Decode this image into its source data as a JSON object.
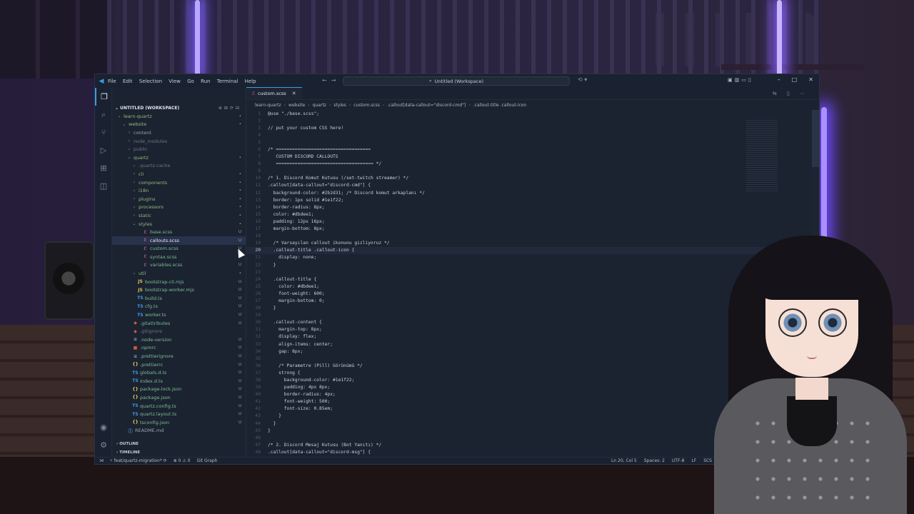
{
  "window": {
    "menu": [
      "File",
      "Edit",
      "Selection",
      "View",
      "Go",
      "Run",
      "Terminal",
      "Help"
    ],
    "search_title": "Untitled (Workspace)"
  },
  "sidebar": {
    "workspace": "UNTITLED (WORKSPACE)",
    "tree": [
      {
        "label": "learn-quartz",
        "depth": 0,
        "kind": "folder",
        "open": true,
        "status": "•",
        "status_kind": "mod"
      },
      {
        "label": "website",
        "depth": 1,
        "kind": "folder",
        "open": true,
        "status": "•",
        "status_kind": "mod"
      },
      {
        "label": "content",
        "depth": 2,
        "kind": "folder",
        "open": false,
        "status": "",
        "status_kind": ""
      },
      {
        "label": "node_modules",
        "depth": 2,
        "kind": "folder",
        "open": false,
        "status": "",
        "status_kind": "ign"
      },
      {
        "label": "public",
        "depth": 2,
        "kind": "folder",
        "open": false,
        "status": "",
        "status_kind": "ign"
      },
      {
        "label": "quartz",
        "depth": 2,
        "kind": "folder",
        "open": true,
        "status": "•",
        "status_kind": "mod"
      },
      {
        "label": ".quartz-cache",
        "depth": 3,
        "kind": "folder",
        "open": false,
        "status": "",
        "status_kind": "ign"
      },
      {
        "label": "cli",
        "depth": 3,
        "kind": "folder",
        "open": false,
        "status": "•",
        "status_kind": "mod"
      },
      {
        "label": "components",
        "depth": 3,
        "kind": "folder",
        "open": false,
        "status": "•",
        "status_kind": "mod"
      },
      {
        "label": "i18n",
        "depth": 3,
        "kind": "folder",
        "open": false,
        "status": "•",
        "status_kind": "mod"
      },
      {
        "label": "plugins",
        "depth": 3,
        "kind": "folder",
        "open": false,
        "status": "•",
        "status_kind": "mod"
      },
      {
        "label": "processors",
        "depth": 3,
        "kind": "folder",
        "open": false,
        "status": "•",
        "status_kind": "mod"
      },
      {
        "label": "static",
        "depth": 3,
        "kind": "folder",
        "open": false,
        "status": "•",
        "status_kind": "mod"
      },
      {
        "label": "styles",
        "depth": 3,
        "kind": "folder",
        "open": true,
        "status": "•",
        "status_kind": "mod"
      },
      {
        "label": "base.scss",
        "depth": 4,
        "kind": "sass",
        "status": "U",
        "status_kind": "un"
      },
      {
        "label": "callouts.scss",
        "depth": 4,
        "kind": "sass",
        "status": "U",
        "status_kind": "un",
        "selected": true
      },
      {
        "label": "custom.scss",
        "depth": 4,
        "kind": "sass",
        "status": "U",
        "status_kind": "un"
      },
      {
        "label": "syntax.scss",
        "depth": 4,
        "kind": "sass",
        "status": "U",
        "status_kind": "un"
      },
      {
        "label": "variables.scss",
        "depth": 4,
        "kind": "sass",
        "status": "U",
        "status_kind": "un"
      },
      {
        "label": "util",
        "depth": 3,
        "kind": "folder",
        "open": false,
        "status": "•",
        "status_kind": "mod"
      },
      {
        "label": "bootstrap-cli.mjs",
        "depth": 3,
        "kind": "js",
        "status": "U",
        "status_kind": "un"
      },
      {
        "label": "bootstrap-worker.mjs",
        "depth": 3,
        "kind": "js",
        "status": "U",
        "status_kind": "un"
      },
      {
        "label": "build.ts",
        "depth": 3,
        "kind": "ts",
        "status": "U",
        "status_kind": "un"
      },
      {
        "label": "cfg.ts",
        "depth": 3,
        "kind": "ts",
        "status": "U",
        "status_kind": "un"
      },
      {
        "label": "worker.ts",
        "depth": 3,
        "kind": "ts",
        "status": "U",
        "status_kind": "un"
      },
      {
        "label": ".gitattributes",
        "depth": 2,
        "kind": "git",
        "status": "U",
        "status_kind": "un"
      },
      {
        "label": ".gitignore",
        "depth": 2,
        "kind": "git",
        "status": "",
        "status_kind": "ign"
      },
      {
        "label": ".node-version",
        "depth": 2,
        "kind": "txt",
        "status": "U",
        "status_kind": "un"
      },
      {
        "label": ".npmrc",
        "depth": 2,
        "kind": "npm",
        "status": "U",
        "status_kind": "un"
      },
      {
        "label": ".prettierignore",
        "depth": 2,
        "kind": "txt",
        "status": "U",
        "status_kind": "un"
      },
      {
        "label": ".prettierrc",
        "depth": 2,
        "kind": "json",
        "status": "U",
        "status_kind": "un"
      },
      {
        "label": "globals.d.ts",
        "depth": 2,
        "kind": "ts",
        "status": "U",
        "status_kind": "un"
      },
      {
        "label": "index.d.ts",
        "depth": 2,
        "kind": "ts",
        "status": "U",
        "status_kind": "un"
      },
      {
        "label": "package-lock.json",
        "depth": 2,
        "kind": "json",
        "status": "U",
        "status_kind": "un"
      },
      {
        "label": "package.json",
        "depth": 2,
        "kind": "json",
        "status": "U",
        "status_kind": "un"
      },
      {
        "label": "quartz.config.ts",
        "depth": 2,
        "kind": "ts",
        "status": "U",
        "status_kind": "un"
      },
      {
        "label": "quartz.layout.ts",
        "depth": 2,
        "kind": "ts",
        "status": "U",
        "status_kind": "un"
      },
      {
        "label": "tsconfig.json",
        "depth": 2,
        "kind": "json",
        "status": "U",
        "status_kind": "un"
      },
      {
        "label": "README.md",
        "depth": 1,
        "kind": "md",
        "status": "",
        "status_kind": ""
      }
    ],
    "outline": "OUTLINE",
    "timeline": "TIMELINE"
  },
  "editor": {
    "tab": "custom.scss",
    "breadcrumbs": [
      "learn-quartz",
      "website",
      "quartz",
      "styles",
      "custom.scss",
      ".callout[data-callout=\"discord-cmd\"]",
      ".callout-title .callout-icon"
    ],
    "lines": [
      {
        "n": "1",
        "t": "@use \"./base.scss\";"
      },
      {
        "n": "2",
        "t": ""
      },
      {
        "n": "3",
        "t": "// put your custom CSS here!"
      },
      {
        "n": "4",
        "t": ""
      },
      {
        "n": "5",
        "t": ""
      },
      {
        "n": "6",
        "t": "/* ==================================="
      },
      {
        "n": "7",
        "t": "   CUSTOM DISCORD CALLOUTS"
      },
      {
        "n": "8",
        "t": "   ==================================== */"
      },
      {
        "n": "9",
        "t": ""
      },
      {
        "n": "10",
        "t": "/* 1. Discord Komut Kutusu (/set-twitch streamer) */"
      },
      {
        "n": "11",
        "t": ".callout[data-callout=\"discord-cmd\"] {"
      },
      {
        "n": "12",
        "t": "  background-color: #2b2d31; /* Discord komut arkaplanı */"
      },
      {
        "n": "13",
        "t": "  border: 1px solid #1e1f22;"
      },
      {
        "n": "14",
        "t": "  border-radius: 8px;"
      },
      {
        "n": "15",
        "t": "  color: #dbdee1;"
      },
      {
        "n": "16",
        "t": "  padding: 12px 16px;"
      },
      {
        "n": "17",
        "t": "  margin-bottom: 8px;"
      },
      {
        "n": "18",
        "t": ""
      },
      {
        "n": "19",
        "t": "  /* Varsayılan callout ikonunu gizliyoruz */"
      },
      {
        "n": "20",
        "t": "  .callout-title .callout-icon {"
      },
      {
        "n": "21",
        "t": "    display: none;"
      },
      {
        "n": "22",
        "t": "  }"
      },
      {
        "n": "23",
        "t": ""
      },
      {
        "n": "24",
        "t": "  .callout-title {"
      },
      {
        "n": "25",
        "t": "    color: #dbdee1;"
      },
      {
        "n": "26",
        "t": "    font-weight: 600;"
      },
      {
        "n": "27",
        "t": "    margin-bottom: 0;"
      },
      {
        "n": "28",
        "t": "  }"
      },
      {
        "n": "29",
        "t": ""
      },
      {
        "n": "30",
        "t": "  .callout-content {"
      },
      {
        "n": "31",
        "t": "    margin-top: 8px;"
      },
      {
        "n": "32",
        "t": "    display: flex;"
      },
      {
        "n": "33",
        "t": "    align-items: center;"
      },
      {
        "n": "34",
        "t": "    gap: 8px;"
      },
      {
        "n": "35",
        "t": ""
      },
      {
        "n": "36",
        "t": "    /* Parametre (Pill) Görünümü */"
      },
      {
        "n": "37",
        "t": "    strong {"
      },
      {
        "n": "38",
        "t": "      background-color: #1e1f22;"
      },
      {
        "n": "39",
        "t": "      padding: 4px 8px;"
      },
      {
        "n": "40",
        "t": "      border-radius: 4px;"
      },
      {
        "n": "41",
        "t": "      font-weight: 500;"
      },
      {
        "n": "42",
        "t": "      font-size: 0.85em;"
      },
      {
        "n": "43",
        "t": "    }"
      },
      {
        "n": "44",
        "t": "  }"
      },
      {
        "n": "45",
        "t": "}"
      },
      {
        "n": "46",
        "t": ""
      },
      {
        "n": "47",
        "t": "/* 2. Discord Mesaj Kutusu (Bot Yanıtı) */"
      },
      {
        "n": "48",
        "t": ".callout[data-callout=\"discord-msg\"] {"
      }
    ],
    "current_line": "20"
  },
  "statusbar": {
    "branch": "feat/quartz-migration*",
    "problems": "⊗ 0 ⚠ 0",
    "git_graph": "Git Graph",
    "position": "Ln 20, Col 5",
    "spaces": "Spaces: 2",
    "encoding": "UTF-8",
    "eol": "LF",
    "language": "SCS"
  }
}
